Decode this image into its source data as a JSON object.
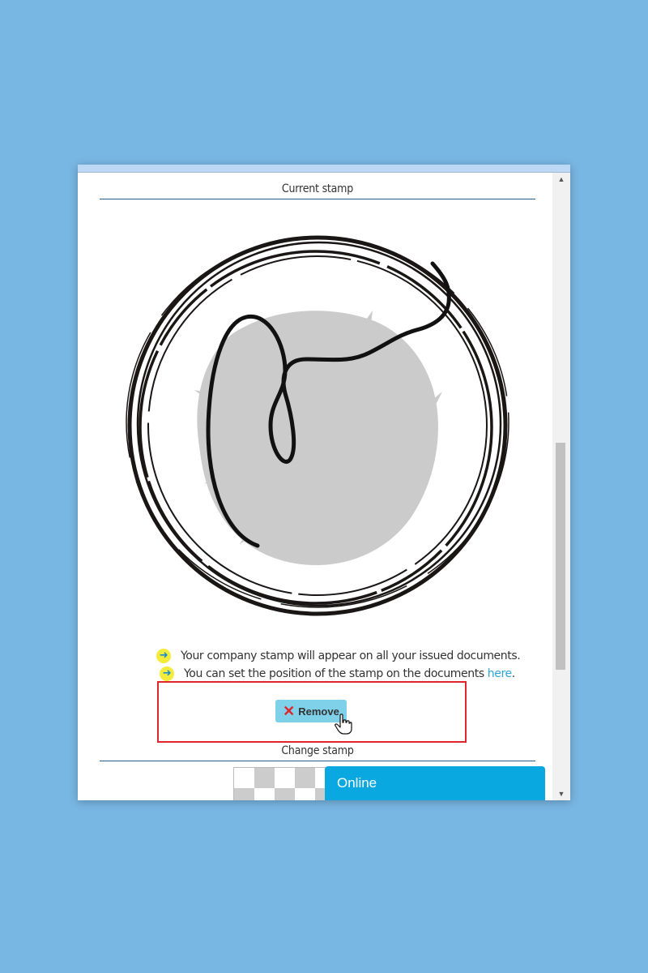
{
  "sections": {
    "current_stamp": "Current stamp",
    "change_stamp": "Change stamp"
  },
  "info": {
    "line1": "Your company stamp will appear on all your issued documents.",
    "line2_prefix": "You can set the position of the stamp on the documents ",
    "line2_link": "here",
    "line2_suffix": "."
  },
  "buttons": {
    "remove": "Remove"
  },
  "chat": {
    "status": "Online"
  },
  "icons": {
    "bullet": "arrow-right-icon",
    "remove": "close-icon",
    "cursor": "hand-pointer-icon",
    "scroll_up": "scroll-up-arrow-icon",
    "scroll_down": "scroll-down-arrow-icon"
  },
  "colors": {
    "page_background": "#78b6e3",
    "accent": "#0aa8e0",
    "remove_button": "#7fd1ea",
    "highlight": "#e0252b",
    "bullet": "#f4ec3a",
    "link": "#2ea7d8"
  }
}
